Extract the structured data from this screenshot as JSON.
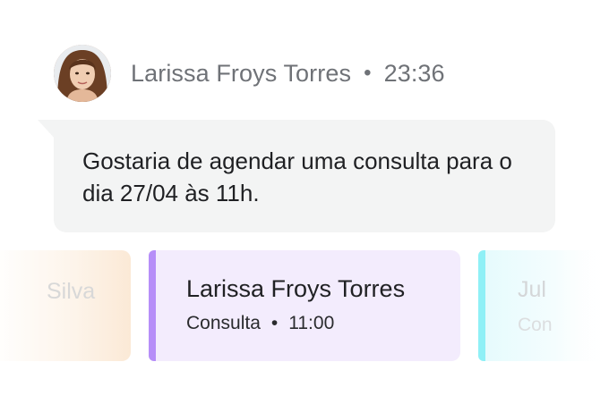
{
  "message": {
    "sender_name": "Larissa Froys Torres",
    "separator": "•",
    "time": "23:36",
    "text": "Gostaria de agendar uma consulta para o dia 27/04 às 11h."
  },
  "cards": {
    "left": {
      "name": "Silva"
    },
    "main": {
      "name": "Larissa Froys Torres",
      "type": "Consulta",
      "separator": "•",
      "time": "11:00",
      "accent_color": "#b68ef8"
    },
    "right": {
      "name": "Jul",
      "type": "Con",
      "accent_color": "#8ff0f6"
    }
  },
  "icons": {
    "avatar": "user-avatar-photo"
  }
}
